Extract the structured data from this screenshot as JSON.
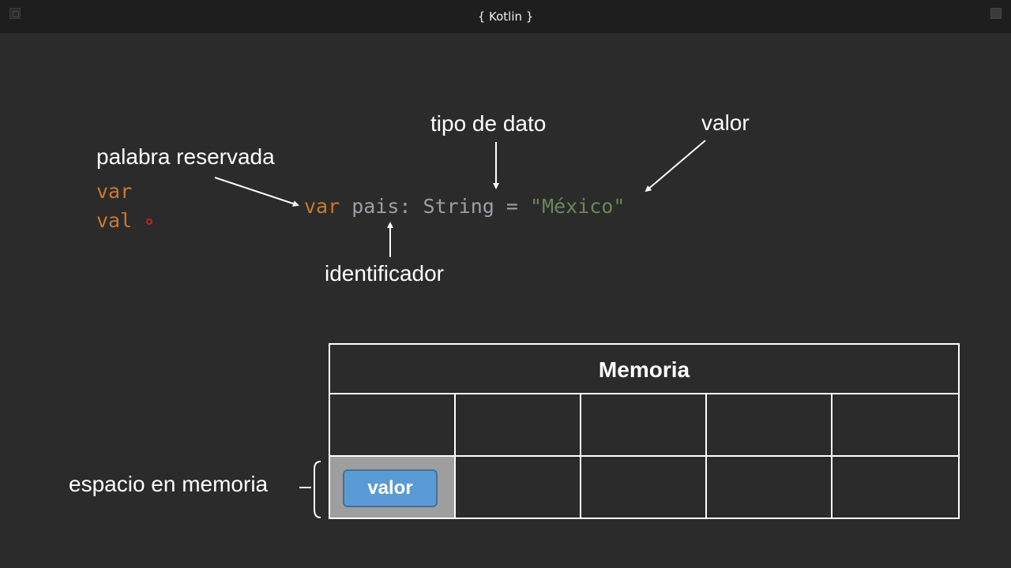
{
  "window": {
    "title": "{ Kotlin }"
  },
  "labels": {
    "keyword": "palabra reservada",
    "data_type": "tipo de dato",
    "value": "valor",
    "identifier": "identificador",
    "memory_space": "espacio en memoria"
  },
  "keywords_list": [
    "var",
    "val"
  ],
  "code_line": {
    "keyword": "var",
    "identifier": "pais:",
    "type": "String",
    "equals": "=",
    "value": "\"México\""
  },
  "memory": {
    "title": "Memoria",
    "chip_label": "valor",
    "rows": 2,
    "columns": 5
  },
  "colors": {
    "background": "#2b2b2b",
    "titlebar": "#1e1e1e",
    "keyword": "#cc7832",
    "identifier": "#9aa0a6",
    "string": "#6a8759",
    "chip": "#5b9bd5",
    "highlight_cell": "#9e9e9e"
  }
}
